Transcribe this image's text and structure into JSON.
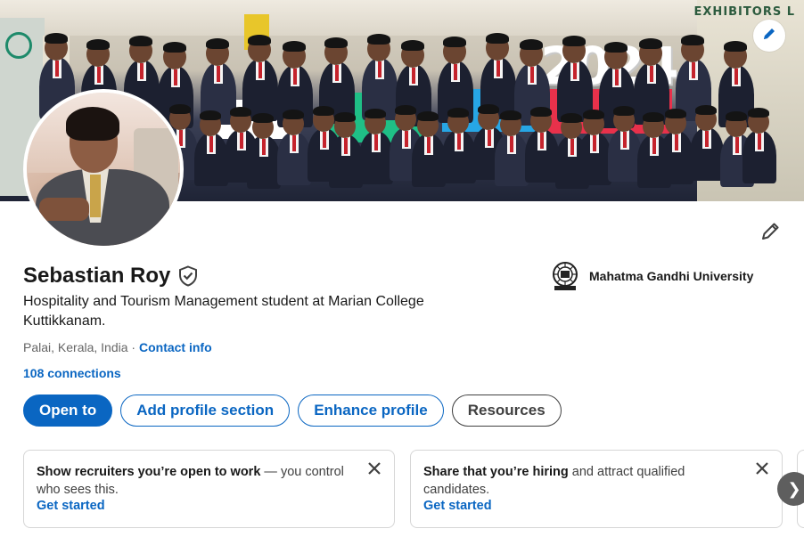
{
  "profile": {
    "name": "Sebastian Roy",
    "headline": "Hospitality and Tourism Management student at Marian College Kuttikkanam.",
    "location": "Palai, Kerala, India",
    "separator": " · ",
    "contact_info": "Contact info",
    "connections": "108 connections"
  },
  "cover": {
    "sign_text": "2024",
    "side_banner": "EXHIBITORS L"
  },
  "organization": {
    "name": "Mahatma Gandhi University",
    "logo_icon": "university-seal-icon"
  },
  "actions": {
    "open_to": "Open to",
    "add_section": "Add profile section",
    "enhance": "Enhance profile",
    "resources": "Resources"
  },
  "cards": [
    {
      "bold": "Show recruiters you’re open to work",
      "rest": " — you control who sees this.",
      "link": "Get started"
    },
    {
      "bold": "Share that you’re hiring",
      "rest": " and attract qualified candidates.",
      "link": "Get started"
    }
  ],
  "carousel": {
    "next_glyph": "❯"
  },
  "colors": {
    "accent": "#0a66c2",
    "text": "#191919",
    "muted": "#666666"
  }
}
